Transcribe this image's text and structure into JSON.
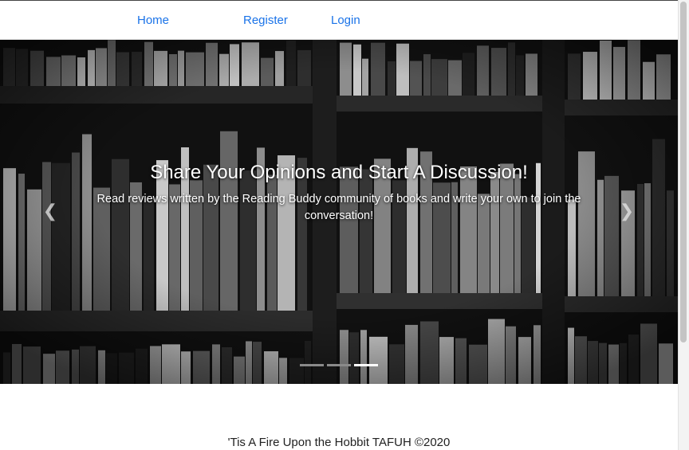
{
  "nav": {
    "home_label": "Home",
    "register_label": "Register",
    "login_label": "Login"
  },
  "carousel": {
    "title": "Share Your Opinions and Start A Discussion!",
    "text": "Read reviews written by the Reading Buddy community of books and write your own to join the conversation!",
    "prev_icon": "chevron-left-icon",
    "next_icon": "chevron-right-icon",
    "slide_count": 3,
    "active_slide": 3
  },
  "footer": {
    "text": "'Tis A Fire Upon the Hobbit TAFUH ©2020"
  },
  "colors": {
    "link": "#1a73e8",
    "carousel_bg": "#0b0b0b",
    "caption": "#ffffff"
  }
}
